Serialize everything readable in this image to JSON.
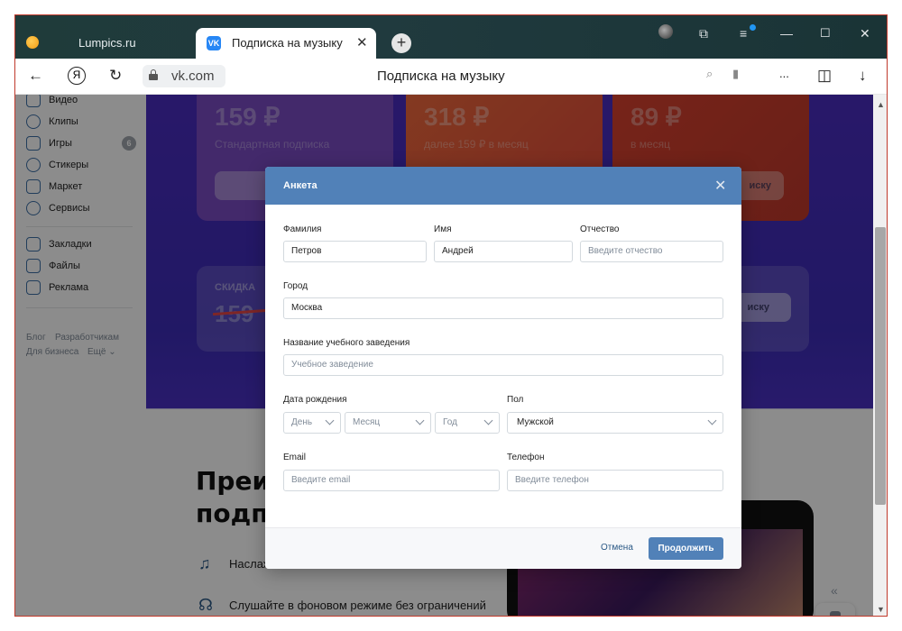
{
  "browser": {
    "tabs": [
      {
        "title": "Lumpics.ru"
      },
      {
        "title": "Подписка на музыку",
        "close_glyph": "✕"
      }
    ],
    "new_tab_glyph": "+",
    "address": {
      "domain": "vk.com",
      "page_title": "Подписка на музыку"
    },
    "nav_glyphs": {
      "back": "←",
      "refresh": "↻",
      "ya": "Я",
      "download": "↓",
      "more": "..."
    }
  },
  "sidebar": {
    "items": [
      {
        "label": "Видео"
      },
      {
        "label": "Клипы"
      },
      {
        "label": "Игры",
        "badge": "6"
      },
      {
        "label": "Стикеры"
      },
      {
        "label": "Маркет"
      },
      {
        "label": "Сервисы"
      },
      {
        "label": "Закладки"
      },
      {
        "label": "Файлы"
      },
      {
        "label": "Реклама"
      }
    ],
    "footer": {
      "blog": "Блог",
      "dev": "Разработчикам",
      "business": "Для бизнеса",
      "more": "Ещё ⌄"
    }
  },
  "background": {
    "prices": [
      {
        "price": "159 ₽",
        "sub": "Стандартная подписка"
      },
      {
        "price": "318 ₽",
        "sub": "далее 159 ₽ в месяц"
      },
      {
        "price": "89 ₽",
        "sub": "в месяц"
      }
    ],
    "cta_fragment": "иску",
    "discount_label": "СКИДКА",
    "discount_old": "159",
    "heading_line1": "Преи",
    "heading_line2": "подп",
    "features": [
      {
        "text": "Наслаж"
      },
      {
        "text": "Слушайте в фоновом режиме без ограничений"
      }
    ],
    "collapse_glyph": "«"
  },
  "modal": {
    "title": "Анкета",
    "close_glyph": "✕",
    "fields": {
      "last_name": {
        "label": "Фамилия",
        "value": "Петров"
      },
      "first_name": {
        "label": "Имя",
        "value": "Андрей"
      },
      "patronymic": {
        "label": "Отчество",
        "placeholder": "Введите отчество"
      },
      "city": {
        "label": "Город",
        "value": "Москва"
      },
      "school": {
        "label": "Название учебного заведения",
        "placeholder": "Учебное заведение"
      },
      "birth": {
        "label": "Дата рождения",
        "day": "День",
        "month": "Месяц",
        "year": "Год"
      },
      "gender": {
        "label": "Пол",
        "value": "Мужской"
      },
      "email": {
        "label": "Email",
        "placeholder": "Введите email"
      },
      "phone": {
        "label": "Телефон",
        "placeholder": "Введите телефон"
      }
    },
    "cancel_label": "Отмена",
    "continue_label": "Продолжить"
  },
  "colors": {
    "accent": "#5181b8",
    "link": "#2a5885",
    "vk_blue": "#2787f5"
  }
}
